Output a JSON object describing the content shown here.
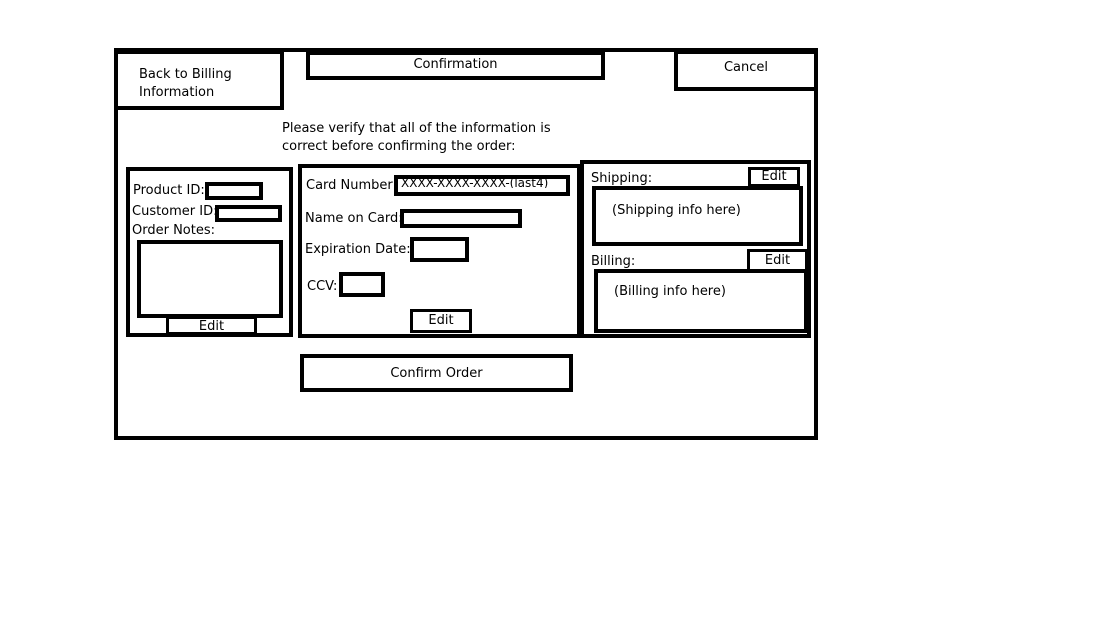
{
  "header": {
    "back_label": "Back to Billing Information",
    "title": "Confirmation",
    "cancel_label": "Cancel"
  },
  "instructions": "Please verify that all of the information is correct before confirming the order:",
  "order_panel": {
    "product_id_label": "Product ID:",
    "customer_id_label": "Customer ID:",
    "order_notes_label": "Order Notes:",
    "edit_label": "Edit"
  },
  "card_panel": {
    "card_number_label": "Card Number:",
    "card_number_value": "XXXX-XXXX-XXXX-(last4)",
    "name_on_card_label": "Name on Card:",
    "expiration_label": "Expiration Date:",
    "ccv_label": "CCV:",
    "edit_label": "Edit"
  },
  "address_panel": {
    "shipping_label": "Shipping:",
    "shipping_edit_label": "Edit",
    "shipping_info": "(Shipping info here)",
    "billing_label": "Billing:",
    "billing_edit_label": "Edit",
    "billing_info": "(Billing info here)"
  },
  "confirm_label": "Confirm Order"
}
